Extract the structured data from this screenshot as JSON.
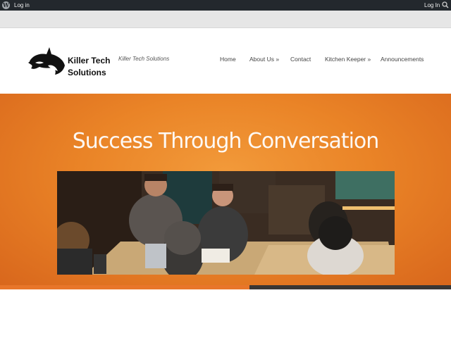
{
  "adminbar": {
    "login_left": "Log in",
    "login_right": "Log In",
    "wp_icon": "wordpress-icon",
    "search_icon": "search-icon"
  },
  "header": {
    "brand_line1": "Killer Tech",
    "brand_line2": "Solutions",
    "tagline": "Killer Tech Solutions",
    "logo_icon": "orca-icon"
  },
  "nav": {
    "items": [
      {
        "label": "Home"
      },
      {
        "label": "About Us »"
      },
      {
        "label": "Contact"
      },
      {
        "label": "Kitchen Keeper »"
      },
      {
        "label": "Announcements"
      }
    ]
  },
  "hero": {
    "title": "Success Through Conversation"
  },
  "colors": {
    "accent_orange": "#e8762a",
    "admin_bar": "#23282d",
    "slider_bar_dark": "#3a3634"
  }
}
